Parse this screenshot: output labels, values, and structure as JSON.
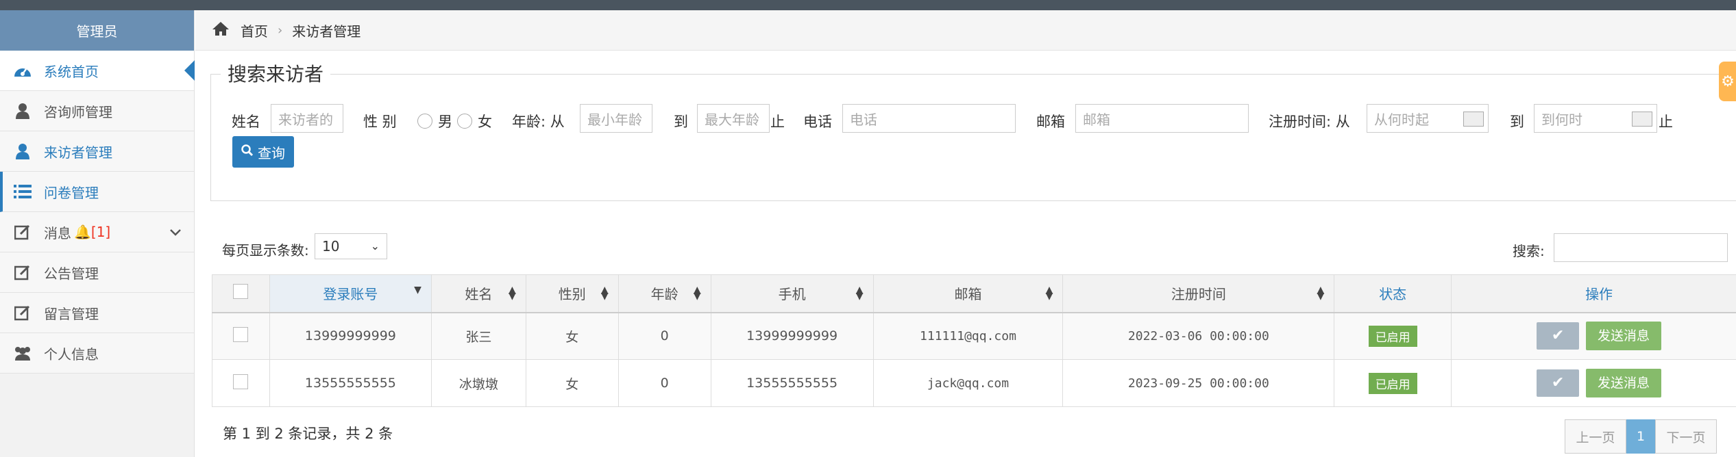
{
  "sidebar": {
    "header": "管理员",
    "items": [
      {
        "label": "系统首页"
      },
      {
        "label": "咨询师管理"
      },
      {
        "label": "来访者管理"
      },
      {
        "label": "问卷管理"
      },
      {
        "label": "消息",
        "badge": "[1]"
      },
      {
        "label": "公告管理"
      },
      {
        "label": "留言管理"
      },
      {
        "label": "个人信息"
      }
    ]
  },
  "breadcrumb": {
    "home": "首页",
    "current": "来访者管理"
  },
  "search": {
    "title": "搜索来访者",
    "name_label": "姓名",
    "name_placeholder": "来访者的",
    "gender_label": "性 别",
    "male": "男",
    "female": "女",
    "age_label": "年龄: 从",
    "age_min_placeholder": "最小年龄",
    "to1": "到",
    "age_max_placeholder": "最大年龄",
    "stop1": "止",
    "phone_label": "电话",
    "phone_placeholder": "电话",
    "email_label": "邮箱",
    "email_placeholder": "邮箱",
    "reg_label": "注册时间: 从",
    "reg_from_placeholder": "从何时起",
    "to2": "到",
    "reg_to_placeholder": "到何时",
    "stop2": "止",
    "query_button": "查询"
  },
  "list": {
    "per_page_label": "每页显示条数:",
    "per_page_value": "10",
    "search_label": "搜索:"
  },
  "table": {
    "headers": [
      "登录账号",
      "姓名",
      "性别",
      "年龄",
      "手机",
      "邮箱",
      "注册时间",
      "状态",
      "操作"
    ],
    "rows": [
      {
        "account": "13999999999",
        "name": "张三",
        "gender": "女",
        "age": "0",
        "phone": "13999999999",
        "email": "111111@qq.com",
        "reg_time": "2022-03-06 00:00:00",
        "status": "已启用",
        "action": "发送消息"
      },
      {
        "account": "13555555555",
        "name": "冰墩墩",
        "gender": "女",
        "age": "0",
        "phone": "13555555555",
        "email": "jack@qq.com",
        "reg_time": "2023-09-25 00:00:00",
        "status": "已启用",
        "action": "发送消息"
      }
    ]
  },
  "footer": {
    "summary": "第 1 到 2 条记录，共 2 条",
    "prev": "上一页",
    "page": "1",
    "next": "下一页"
  },
  "colors": {
    "accent": "#2b7dbc",
    "status_green": "#72ad50",
    "sidebar_header": "#6a8fb3"
  }
}
